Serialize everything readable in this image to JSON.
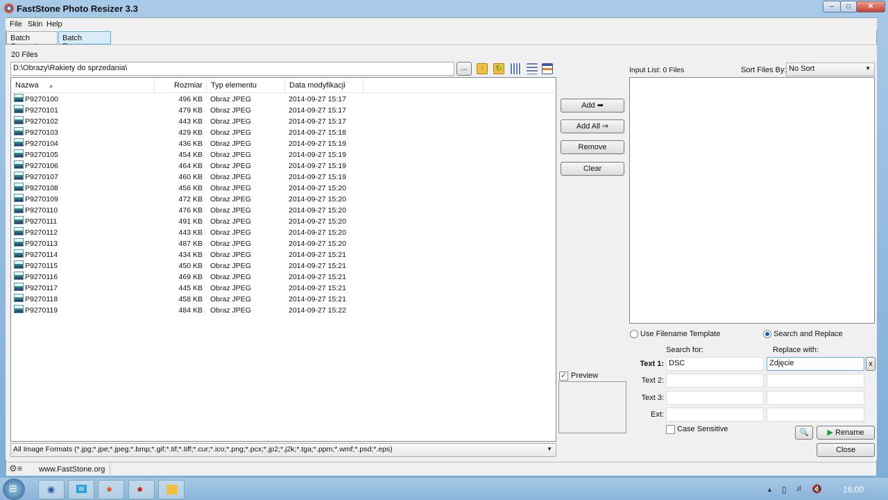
{
  "window": {
    "title": "FastStone Photo Resizer 3.3",
    "controls": [
      "minimize",
      "maximize",
      "close"
    ]
  },
  "menu": [
    "File",
    "Skin",
    "Help"
  ],
  "tabs": [
    {
      "label": "Batch Convert",
      "active": false
    },
    {
      "label": "Batch Rename",
      "active": true
    }
  ],
  "source": {
    "file_count": "20 Files",
    "path": "D:\\Obrazy\\Rakiety do sprzedania\\",
    "browse_label": "...",
    "toolbar_icons": [
      "folder-up-icon",
      "folder-refresh-icon",
      "thumbnail-view-icon",
      "list-view-icon",
      "details-view-icon"
    ],
    "columns": [
      "Nazwa",
      "Rozmiar",
      "Typ elementu",
      "Data modyfikacji"
    ],
    "files": [
      [
        "P9270100",
        "496 KB",
        "Obraz JPEG",
        "2014-09-27 15:17"
      ],
      [
        "P9270101",
        "479 KB",
        "Obraz JPEG",
        "2014-09-27 15:17"
      ],
      [
        "P9270102",
        "443 KB",
        "Obraz JPEG",
        "2014-09-27 15:17"
      ],
      [
        "P9270103",
        "429 KB",
        "Obraz JPEG",
        "2014-09-27 15:18"
      ],
      [
        "P9270104",
        "436 KB",
        "Obraz JPEG",
        "2014-09-27 15:19"
      ],
      [
        "P9270105",
        "454 KB",
        "Obraz JPEG",
        "2014-09-27 15:19"
      ],
      [
        "P9270106",
        "464 KB",
        "Obraz JPEG",
        "2014-09-27 15:19"
      ],
      [
        "P9270107",
        "460 KB",
        "Obraz JPEG",
        "2014-09-27 15:19"
      ],
      [
        "P9270108",
        "456 KB",
        "Obraz JPEG",
        "2014-09-27 15:20"
      ],
      [
        "P9270109",
        "472 KB",
        "Obraz JPEG",
        "2014-09-27 15:20"
      ],
      [
        "P9270110",
        "476 KB",
        "Obraz JPEG",
        "2014-09-27 15:20"
      ],
      [
        "P9270111",
        "491 KB",
        "Obraz JPEG",
        "2014-09-27 15:20"
      ],
      [
        "P9270112",
        "443 KB",
        "Obraz JPEG",
        "2014-09-27 15:20"
      ],
      [
        "P9270113",
        "487 KB",
        "Obraz JPEG",
        "2014-09-27 15:20"
      ],
      [
        "P9270114",
        "434 KB",
        "Obraz JPEG",
        "2014-09-27 15:21"
      ],
      [
        "P9270115",
        "450 KB",
        "Obraz JPEG",
        "2014-09-27 15:21"
      ],
      [
        "P9270116",
        "469 KB",
        "Obraz JPEG",
        "2014-09-27 15:21"
      ],
      [
        "P9270117",
        "445 KB",
        "Obraz JPEG",
        "2014-09-27 15:21"
      ],
      [
        "P9270118",
        "458 KB",
        "Obraz JPEG",
        "2014-09-27 15:21"
      ],
      [
        "P9270119",
        "484 KB",
        "Obraz JPEG",
        "2014-09-27 15:22"
      ]
    ],
    "filter": "All Image Formats (*.jpg;*.jpe;*.jpeg;*.bmp;*.gif;*.tif;*.tiff;*.cur;*.ico;*.png;*.pcx;*.jp2;*.j2k;*.tga;*.ppm;*.wmf;*.psd;*.eps)"
  },
  "buttons": {
    "add": "Add",
    "add_all": "Add All",
    "remove": "Remove",
    "clear": "Clear"
  },
  "input_list": {
    "label": "Input List:  0 Files",
    "sort_label": "Sort Files By:",
    "sort_value": "No Sort"
  },
  "rename": {
    "mode_template": "Use Filename Template",
    "mode_search": "Search and Replace",
    "selected_mode": "Search and Replace",
    "search_header": "Search for:",
    "replace_header": "Replace with:",
    "rows": [
      {
        "label": "Text 1:",
        "search": "DSC",
        "replace": "Zdjęcie"
      },
      {
        "label": "Text 2:",
        "search": "",
        "replace": ""
      },
      {
        "label": "Text 3:",
        "search": "",
        "replace": ""
      },
      {
        "label": "Ext:",
        "search": "",
        "replace": ""
      }
    ],
    "clear_x": "x",
    "case_sensitive_label": "Case Sensitive",
    "case_sensitive": false,
    "preview_label": "Preview",
    "preview_checked": true,
    "rename_label": "Rename",
    "close_label": "Close"
  },
  "status": {
    "website": "www.FastStone.org"
  },
  "taskbar": {
    "clock": "16:00"
  },
  "colors": {
    "accent": "#5ab0e0",
    "play_green": "#1a9a3a"
  }
}
